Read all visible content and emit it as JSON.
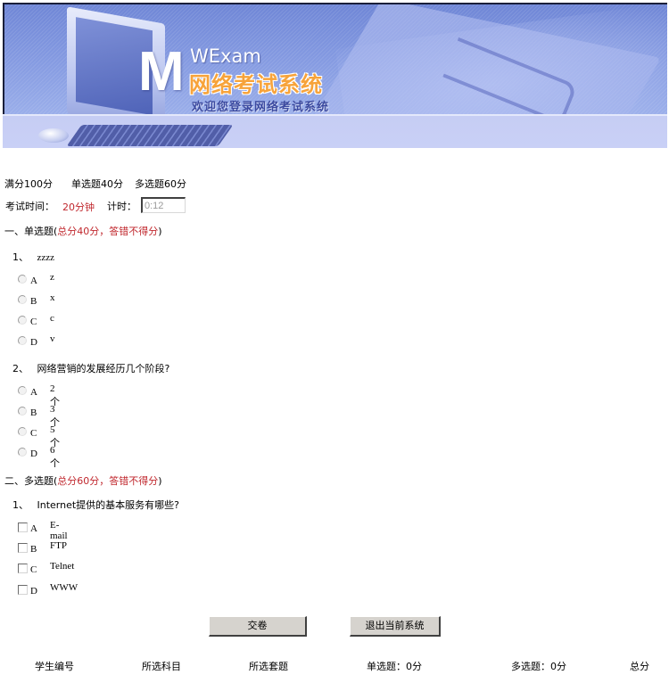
{
  "banner": {
    "logo_letter": "M",
    "logo_brand": "WExam",
    "system_title": "网络考试系统",
    "welcome_text": "欢迎您登录网络考试系统"
  },
  "summary": {
    "full_score": "满分100分",
    "single_score": "单选题40分",
    "multi_score": "多选题60分",
    "time_label": "考试时间：",
    "time_value": "20分钟",
    "timer_label": "计时：",
    "timer_value": "0:12"
  },
  "sections": [
    {
      "heading": "一、单选题",
      "note_open": "(",
      "note": "总分40分，答错不得分",
      "note_close": ")",
      "type": "radio",
      "questions": [
        {
          "number": "1、",
          "text": "zzzz",
          "options": [
            {
              "letter": "A",
              "text": "z"
            },
            {
              "letter": "B",
              "text": "x"
            },
            {
              "letter": "C",
              "text": "c"
            },
            {
              "letter": "D",
              "text": "v"
            }
          ]
        },
        {
          "number": "2、",
          "text": "网络营销的发展经历几个阶段?",
          "options": [
            {
              "letter": "A",
              "text": "2个"
            },
            {
              "letter": "B",
              "text": "3个"
            },
            {
              "letter": "C",
              "text": "5个"
            },
            {
              "letter": "D",
              "text": "6个"
            }
          ]
        }
      ]
    },
    {
      "heading": "二、多选题",
      "note_open": "(",
      "note": "总分60分，答错不得分",
      "note_close": ")",
      "type": "checkbox",
      "questions": [
        {
          "number": "1、",
          "text": "Internet提供的基本服务有哪些?",
          "options": [
            {
              "letter": "A",
              "text": "E-mail"
            },
            {
              "letter": "B",
              "text": "FTP"
            },
            {
              "letter": "C",
              "text": "Telnet"
            },
            {
              "letter": "D",
              "text": "WWW"
            }
          ]
        }
      ]
    }
  ],
  "buttons": {
    "submit": "交卷",
    "exit": "退出当前系统"
  },
  "footer": {
    "student_id": "学生编号",
    "subject": "所选科目",
    "paper": "所选套题",
    "single_result": "单选题：0分",
    "multi_result": "多选题：0分",
    "total": "总分"
  },
  "colors": {
    "accent_red": "#c0272d",
    "banner_blue": "#7f93dc",
    "subbanner": "#c8cff5",
    "logo_orange": "#f7a33a"
  }
}
